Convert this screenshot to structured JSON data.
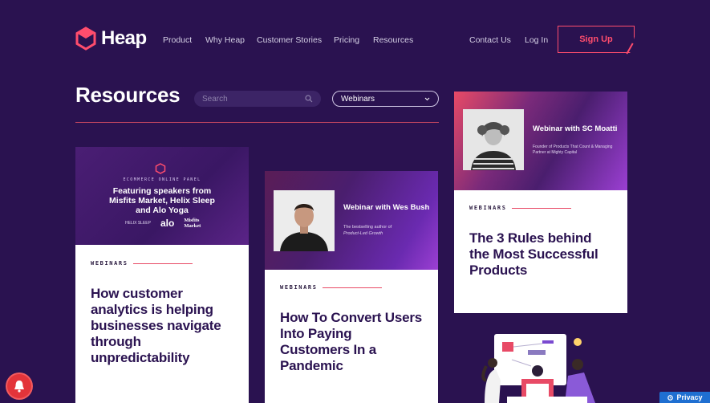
{
  "brand": {
    "name": "Heap",
    "accent": "#ff4d6d",
    "background": "#2a1250"
  },
  "nav": {
    "links": [
      "Product",
      "Why Heap",
      "Customer Stories",
      "Pricing",
      "Resources"
    ],
    "contact": "Contact Us",
    "login": "Log In",
    "signup": "Sign Up"
  },
  "page": {
    "title": "Resources"
  },
  "search": {
    "placeholder": "Search",
    "icon": "search-icon"
  },
  "filter": {
    "selected": "Webinars",
    "icon": "chevron-down-icon"
  },
  "cards": [
    {
      "tag": "WEBINARS",
      "title": "How customer analytics is helping businesses navigate through unpredictability",
      "banner": {
        "kicker": "ECOMMERCE ONLINE PANEL",
        "heading": "Featuring speakers from Misfits Market, Helix Sleep and Alo Yoga",
        "logos": [
          "HELIX SLEEP",
          "alo",
          "Misfits Market"
        ]
      }
    },
    {
      "tag": "WEBINARS",
      "title": "How To Convert Users Into Paying Customers In a Pandemic",
      "banner": {
        "heading": "Webinar with Wes Bush",
        "subtitle": "The bestselling author of",
        "subtitle_em": "Product-Led Growth"
      }
    },
    {
      "tag": "WEBINARS",
      "title": "The 3 Rules behind the Most Successful Products",
      "banner": {
        "heading": "Webinar with SC Moatti",
        "subtitle": "Founder of Products That Count & Managing Partner at Mighty Capital"
      }
    }
  ],
  "privacy": "Privacy"
}
